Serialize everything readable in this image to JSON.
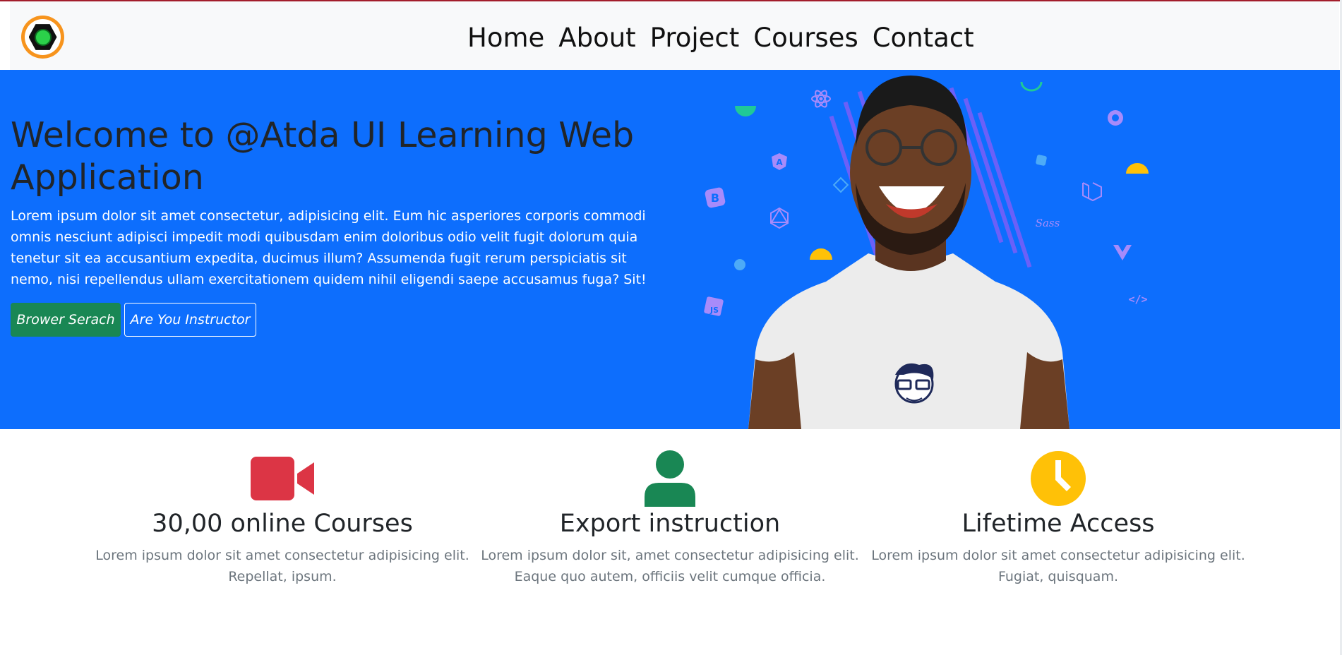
{
  "nav": {
    "links": [
      "Home",
      "About",
      "Project",
      "Courses",
      "Contact"
    ]
  },
  "hero": {
    "title": "Welcome to @Atda UI Learning Web Application",
    "text": "Lorem ipsum dolor sit amet consectetur, adipisicing elit. Eum hic asperiores corporis commodi omnis nesciunt adipisci impedit modi quibusdam enim doloribus odio velit fugit dolorum quia tenetur sit ea accusantium expedita, ducimus illum? Assumenda fugit rerum perspiciatis sit nemo, nisi repellendus ullam exercitationem quidem nihil eligendi saepe accusamus fuga? Sit!",
    "primary_button": "Brower Serach",
    "secondary_button": "Are You Instructor"
  },
  "features": [
    {
      "icon": "video-camera-icon",
      "color": "#dc3545",
      "title": "30,00 online Courses",
      "text": "Lorem ipsum dolor sit amet consectetur adipisicing elit. Repellat, ipsum."
    },
    {
      "icon": "person-icon",
      "color": "#198754",
      "title": "Export instruction",
      "text": "Lorem ipsum dolor sit, amet consectetur adipisicing elit. Eaque quo autem, officiis velit cumque officia."
    },
    {
      "icon": "clock-icon",
      "color": "#ffc107",
      "title": "Lifetime Access",
      "text": "Lorem ipsum dolor sit amet consectetur adipisicing elit. Fugiat, quisquam."
    }
  ],
  "colors": {
    "hero_bg": "#0d6efd",
    "navbar_bg": "#f8f9fa",
    "button_green": "#198754"
  }
}
